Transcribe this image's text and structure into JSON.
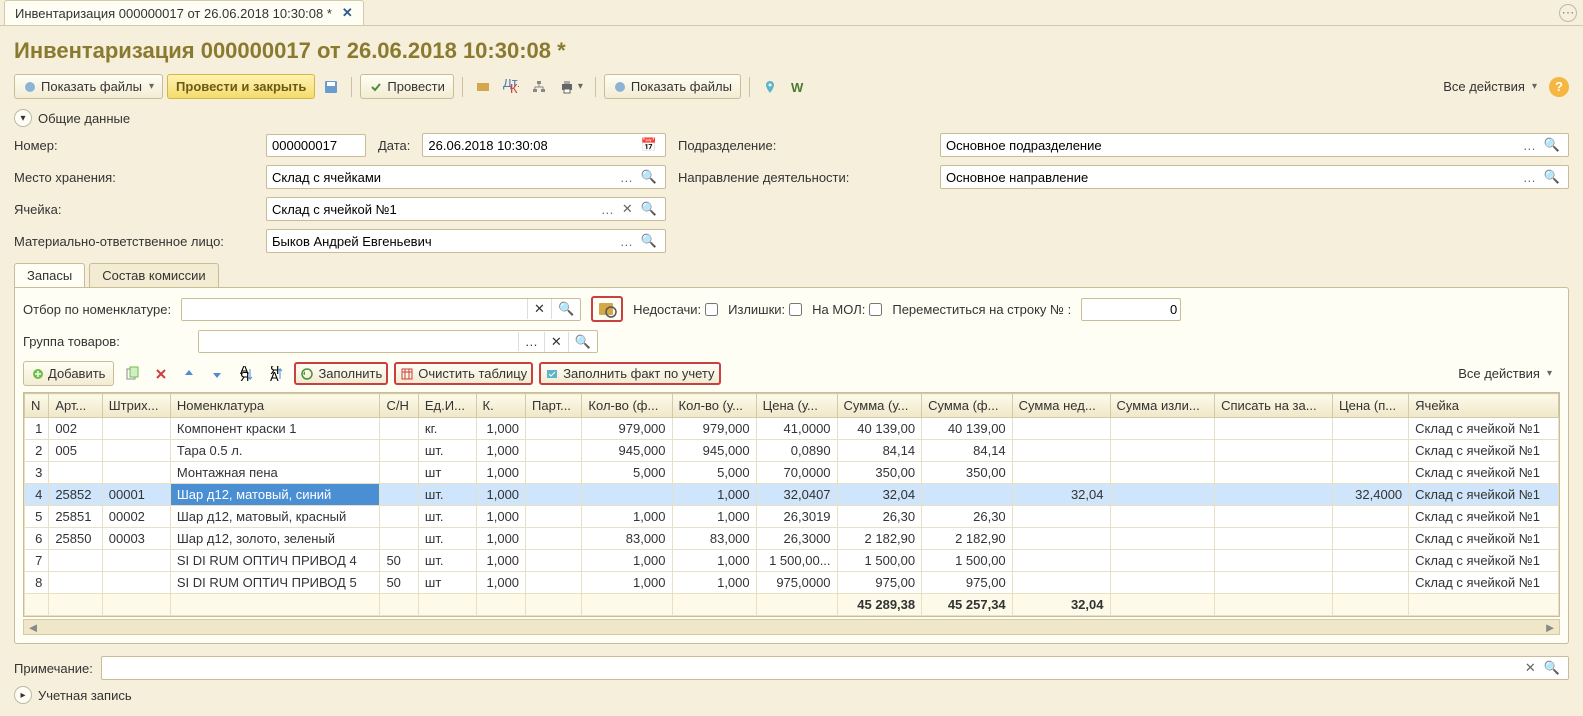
{
  "doc_tab_title": "Инвентаризация 000000017 от 26.06.2018 10:30:08 *",
  "page_title": "Инвентаризация 000000017 от 26.06.2018 10:30:08 *",
  "toolbar": {
    "show_files": "Показать файлы",
    "post_close": "Провести и закрыть",
    "post": "Провести",
    "show_files2": "Показать файлы",
    "all_actions": "Все действия"
  },
  "sections": {
    "general": "Общие данные",
    "account": "Учетная запись"
  },
  "fields": {
    "number_lbl": "Номер:",
    "number_val": "000000017",
    "date_lbl": "Дата:",
    "date_val": "26.06.2018 10:30:08",
    "dept_lbl": "Подразделение:",
    "dept_val": "Основное подразделение",
    "storage_lbl": "Место хранения:",
    "storage_val": "Склад с ячейками",
    "activity_lbl": "Направление деятельности:",
    "activity_val": "Основное направление",
    "cell_lbl": "Ячейка:",
    "cell_val": "Склад с ячейкой №1",
    "mol_lbl": "Материально-ответственное лицо:",
    "mol_val": "Быков Андрей Евгеньевич"
  },
  "tabs": {
    "stocks": "Запасы",
    "commission": "Состав комиссии"
  },
  "filters": {
    "by_nomen": "Отбор по номенклатуре:",
    "group": "Группа товаров:",
    "shortage": "Недостачи:",
    "surplus": "Излишки:",
    "on_mol": "На МОЛ:",
    "goto_row": "Переместиться на строку №",
    "goto_val": "0"
  },
  "tbl_toolbar": {
    "add": "Добавить",
    "fill": "Заполнить",
    "clear": "Очистить таблицу",
    "fill_fact": "Заполнить факт по учету",
    "all_actions": "Все действия"
  },
  "columns": [
    "N",
    "Арт...",
    "Штрих...",
    "Номенклатура",
    "С/Н",
    "Ед.И...",
    "К.",
    "Парт...",
    "Кол-во (ф...",
    "Кол-во (у...",
    "Цена (у...",
    "Сумма (у...",
    "Сумма (ф...",
    "Сумма нед...",
    "Сумма изли...",
    "Списать на за...",
    "Цена (п...",
    "Ячейка"
  ],
  "rows": [
    {
      "n": "1",
      "art": "002",
      "bar": "",
      "nom": "Компонент краски 1",
      "sn": "",
      "ed": "кг.",
      "k": "1,000",
      "part": "",
      "qf": "979,000",
      "qu": "979,000",
      "pu": "41,0000",
      "su": "40 139,00",
      "sf": "40 139,00",
      "nd": "",
      "iz": "",
      "sp": "",
      "pp": "",
      "cell": "Склад с ячейкой №1"
    },
    {
      "n": "2",
      "art": "005",
      "bar": "",
      "nom": "Тара 0.5 л.",
      "sn": "",
      "ed": "шт.",
      "k": "1,000",
      "part": "",
      "qf": "945,000",
      "qu": "945,000",
      "pu": "0,0890",
      "su": "84,14",
      "sf": "84,14",
      "nd": "",
      "iz": "",
      "sp": "",
      "pp": "",
      "cell": "Склад с ячейкой №1"
    },
    {
      "n": "3",
      "art": "",
      "bar": "",
      "nom": "Монтажная пена",
      "sn": "",
      "ed": "шт",
      "k": "1,000",
      "part": "",
      "qf": "5,000",
      "qu": "5,000",
      "pu": "70,0000",
      "su": "350,00",
      "sf": "350,00",
      "nd": "",
      "iz": "",
      "sp": "",
      "pp": "",
      "cell": "Склад с ячейкой №1"
    },
    {
      "n": "4",
      "art": "25852",
      "bar": "00001",
      "nom": "Шар д12, матовый, синий",
      "sn": "",
      "ed": "шт.",
      "k": "1,000",
      "part": "",
      "qf": "",
      "qu": "1,000",
      "pu": "32,0407",
      "su": "32,04",
      "sf": "",
      "nd": "32,04",
      "iz": "",
      "sp": "",
      "pp": "32,4000",
      "cell": "Склад с ячейкой №1",
      "selected": true
    },
    {
      "n": "5",
      "art": "25851",
      "bar": "00002",
      "nom": "Шар д12, матовый, красный",
      "sn": "",
      "ed": "шт.",
      "k": "1,000",
      "part": "",
      "qf": "1,000",
      "qu": "1,000",
      "pu": "26,3019",
      "su": "26,30",
      "sf": "26,30",
      "nd": "",
      "iz": "",
      "sp": "",
      "pp": "",
      "cell": "Склад с ячейкой №1"
    },
    {
      "n": "6",
      "art": "25850",
      "bar": "00003",
      "nom": "Шар д12, золото, зеленый",
      "sn": "",
      "ed": "шт.",
      "k": "1,000",
      "part": "",
      "qf": "83,000",
      "qu": "83,000",
      "pu": "26,3000",
      "su": "2 182,90",
      "sf": "2 182,90",
      "nd": "",
      "iz": "",
      "sp": "",
      "pp": "",
      "cell": "Склад с ячейкой №1"
    },
    {
      "n": "7",
      "art": "",
      "bar": "",
      "nom": "SI DI RUM ОПТИЧ ПРИВОД 4",
      "sn": "50",
      "ed": "шт.",
      "k": "1,000",
      "part": "",
      "qf": "1,000",
      "qu": "1,000",
      "pu": "1 500,00...",
      "su": "1 500,00",
      "sf": "1 500,00",
      "nd": "",
      "iz": "",
      "sp": "",
      "pp": "",
      "cell": "Склад с ячейкой №1"
    },
    {
      "n": "8",
      "art": "",
      "bar": "",
      "nom": "SI DI RUM ОПТИЧ ПРИВОД 5",
      "sn": "50",
      "ed": "шт",
      "k": "1,000",
      "part": "",
      "qf": "1,000",
      "qu": "1,000",
      "pu": "975,0000",
      "su": "975,00",
      "sf": "975,00",
      "nd": "",
      "iz": "",
      "sp": "",
      "pp": "",
      "cell": "Склад с ячейкой №1"
    }
  ],
  "totals": {
    "su": "45 289,38",
    "sf": "45 257,34",
    "nd": "32,04"
  },
  "note_lbl": "Примечание:"
}
